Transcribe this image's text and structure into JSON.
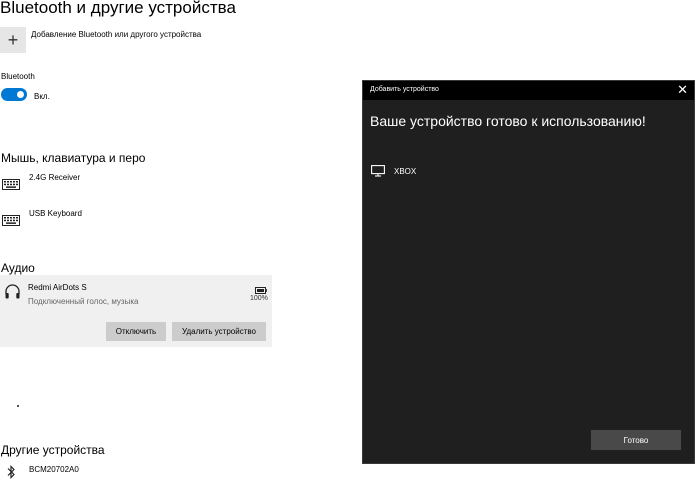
{
  "settings": {
    "page_title": "Bluetooth и другие устройства",
    "add_device_label": "Добавление Bluetooth или другого устройства",
    "bluetooth": {
      "section_label": "Bluetooth",
      "toggle_state_label": "Вкл."
    },
    "mouse_keyboard_section": {
      "heading": "Мышь, клавиатура и перо",
      "devices": [
        "2.4G Receiver",
        "USB Keyboard"
      ]
    },
    "audio_section": {
      "heading": "Аудио",
      "device": {
        "name": "Redmi AirDots S",
        "status": "Подключенный голос, музыка",
        "battery_percent": "100%",
        "disconnect_label": "Отключить",
        "remove_label": "Удалить устройство"
      }
    },
    "other_section": {
      "heading": "Другие устройства",
      "devices": [
        "BCM20702A0"
      ]
    }
  },
  "dialog": {
    "title": "Добавить устройство",
    "close_glyph": "✕",
    "heading": "Ваше устройство готово к использованию!",
    "device_name": "XBOX",
    "done_label": "Готово"
  },
  "colors": {
    "accent": "#0078d4",
    "dialog_background": "#1f1f1f",
    "dialog_titlebar": "#000000",
    "card_background": "#f0f0f0"
  },
  "icons": {
    "add": "plus-icon",
    "keyboard": "keyboard-icon",
    "headphones": "headphones-icon",
    "battery": "battery-icon",
    "bluetooth": "bluetooth-icon",
    "monitor": "monitor-icon",
    "close": "close-icon"
  }
}
